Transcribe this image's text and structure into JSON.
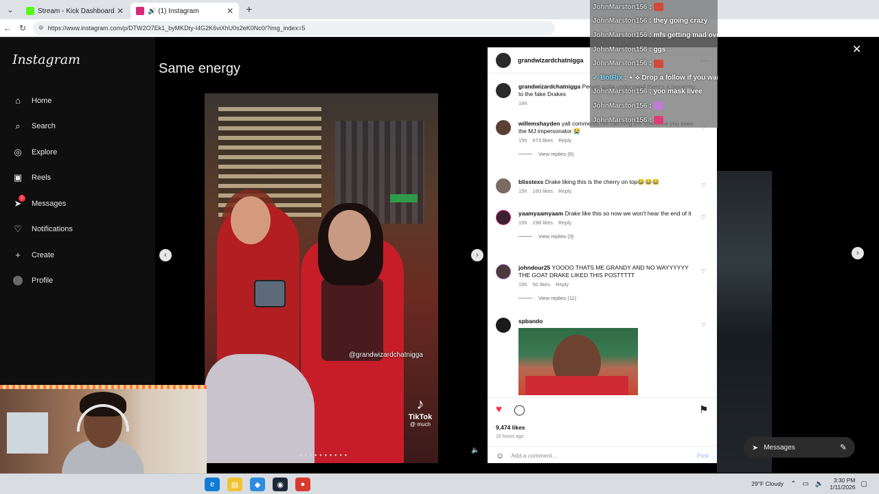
{
  "browser": {
    "tabs": [
      {
        "title": "Stream - Kick Dashboard",
        "favicon_color": "#53fc18",
        "active": false
      },
      {
        "title": "(1) Instagram",
        "favicon_color": "#d62976",
        "active": true
      }
    ],
    "url": "https://www.instagram.com/p/DTW2O7Ek1_byMKDty-I4G2K6viXhU0s2eK0Nc0/?img_index=5"
  },
  "sidebar": {
    "logo": "Instagram",
    "items": [
      {
        "label": "Home",
        "icon": "⌂"
      },
      {
        "label": "Search",
        "icon": "⌕"
      },
      {
        "label": "Explore",
        "icon": "◎"
      },
      {
        "label": "Reels",
        "icon": "▣"
      },
      {
        "label": "Messages",
        "icon": "➤",
        "badge": "1"
      },
      {
        "label": "Notifications",
        "icon": "♡"
      },
      {
        "label": "Create",
        "icon": "+"
      },
      {
        "label": "Profile",
        "icon": ""
      }
    ]
  },
  "post": {
    "caption_overlay": "Same energy",
    "video_tag": "@grandwizardchatnigga",
    "tiktok_label": "TikTok",
    "tiktok_handle": "@ much",
    "author": "grandwizardchatnigga",
    "likes": "9,474 likes",
    "time_ago": "16 hours ago",
    "add_comment_placeholder": "Add a comment...",
    "post_label": "Post"
  },
  "comments": [
    {
      "user": "grandwizardchatnigga",
      "text": "People gotta understand there's a hierarchy to the fake Drakes",
      "time": "16h",
      "likes": "",
      "reply": "",
      "view_replies": ""
    },
    {
      "user": "willemshayden",
      "text": "yall comments not catching the reference you seen the MJ impersonator 😭",
      "time": "15h",
      "likes": "673 likes",
      "reply": "Reply",
      "view_replies": "View replies (6)"
    },
    {
      "user": "blisstexs",
      "text": "Drake liking this is the cherry on top😂😂😂",
      "time": "15h",
      "likes": "160 likes",
      "reply": "Reply",
      "view_replies": ""
    },
    {
      "user": "yaamyaamyaam",
      "text": "Drake like this so now we won't hear the end of it",
      "time": "15h",
      "likes": "198 likes",
      "reply": "Reply",
      "view_replies": "View replies (3)"
    },
    {
      "user": "johndour25",
      "text": "YOOOO THATS ME GRANDY AND NO WAYYYYYY THE GOAT DRAKE LIKED THIS POSTTTTT",
      "time": "15h",
      "likes": "50 likes",
      "reply": "Reply",
      "view_replies": "View replies (11)"
    },
    {
      "user": "spbando",
      "text": "",
      "time": "",
      "likes": "",
      "reply": "",
      "view_replies": ""
    }
  ],
  "messages_pill": {
    "label": "Messages",
    "badge": "1"
  },
  "chat": [
    {
      "user": "JohnMarston156",
      "text": "",
      "emote": "red"
    },
    {
      "user": "JohnMarston156",
      "text": "they going crazy",
      "emote": ""
    },
    {
      "user": "JohnMarston156",
      "text": "mfs getting mad over a game lmao",
      "emote": "red"
    },
    {
      "user": "JohnMarston156",
      "text": "ggs",
      "emote": ""
    },
    {
      "user": "JohnMarston156",
      "text": "",
      "emote": "red"
    },
    {
      "user": "BotRix",
      "text": "⋆˙⟡ Drop a follow if you want more streams from me!°☆⋆.",
      "emote": ""
    },
    {
      "user": "JohnMarston156",
      "text": "yoo mask livee",
      "emote": ""
    },
    {
      "user": "JohnMarston156",
      "text": "",
      "emote": "purple"
    },
    {
      "user": "JohnMarston156",
      "text": "",
      "emote": "pink"
    }
  ],
  "taskbar": {
    "weather": "29°F  Cloudy",
    "time": "3:30 PM",
    "date": "1/11/2026"
  }
}
